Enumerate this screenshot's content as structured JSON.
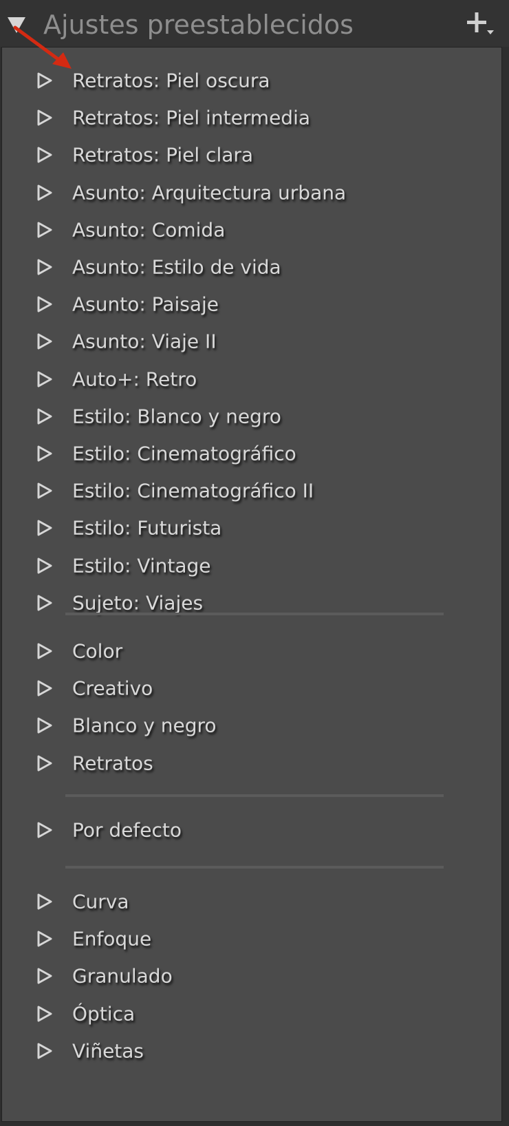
{
  "panel": {
    "title": "Ajustes preestablecidos",
    "add_icon": "plus-dropdown-icon",
    "collapse_icon": "triangle-down-icon",
    "row_icon": "triangle-right-icon"
  },
  "colors": {
    "header_background": "#333333",
    "list_background": "#4b4b4b",
    "title_text": "#8e8e8e",
    "item_text": "#d9d9d9",
    "annotation_arrow": "#d42a12"
  },
  "groups": [
    {
      "items": [
        {
          "label": "Retratos: Piel oscura"
        },
        {
          "label": "Retratos: Piel intermedia"
        },
        {
          "label": "Retratos: Piel clara"
        },
        {
          "label": "Asunto: Arquitectura urbana"
        },
        {
          "label": "Asunto: Comida"
        },
        {
          "label": "Asunto: Estilo de vida"
        },
        {
          "label": "Asunto: Paisaje"
        },
        {
          "label": "Asunto: Viaje II"
        },
        {
          "label": "Auto+: Retro"
        },
        {
          "label": "Estilo: Blanco y negro"
        },
        {
          "label": "Estilo: Cinematográfico"
        },
        {
          "label": "Estilo: Cinematográfico II"
        },
        {
          "label": "Estilo: Futurista"
        },
        {
          "label": "Estilo: Vintage"
        },
        {
          "label": "Sujeto: Viajes"
        }
      ]
    },
    {
      "items": [
        {
          "label": "Color"
        },
        {
          "label": "Creativo"
        },
        {
          "label": "Blanco y negro"
        },
        {
          "label": "Retratos"
        }
      ]
    },
    {
      "items": [
        {
          "label": "Por defecto"
        }
      ]
    },
    {
      "items": [
        {
          "label": "Curva"
        },
        {
          "label": "Enfoque"
        },
        {
          "label": "Granulado"
        },
        {
          "label": "Óptica"
        },
        {
          "label": "Viñetas"
        }
      ]
    }
  ]
}
